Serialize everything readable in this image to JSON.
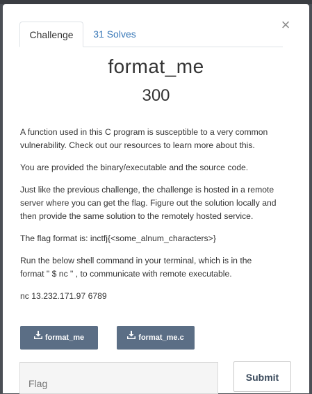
{
  "modal": {
    "close_glyph": "×",
    "tabs": [
      {
        "label": "Challenge"
      },
      {
        "label": "31 Solves"
      }
    ],
    "title": "format_me",
    "points": "300",
    "description": [
      "A function used in this C program is susceptible to a very common vulnerability. Check out our resources to learn more about this.",
      "You are provided the binary/executable and the source code.",
      "Just like the previous challenge, the challenge is hosted in a remote server where you can get the flag. Figure out the solution locally and then provide the same solution to the remotely hosted service.",
      "The flag format is: inctfj{<some_alnum_characters>}",
      "Run the below shell command in your terminal, which is in the format \" $ nc \" , to communicate with remote executable.",
      "nc 13.232.171.97 6789"
    ],
    "downloads": [
      {
        "label": "format_me",
        "icon": "download-icon"
      },
      {
        "label": "format_me.c",
        "icon": "download-icon"
      }
    ],
    "flag_input": {
      "placeholder": "Flag",
      "value": ""
    },
    "submit_label": "Submit"
  },
  "colors": {
    "backdrop": "#4b4f55",
    "tab_link": "#3a79b8",
    "download_button": "#5b6e85",
    "input_bg": "#f5f5f5"
  }
}
